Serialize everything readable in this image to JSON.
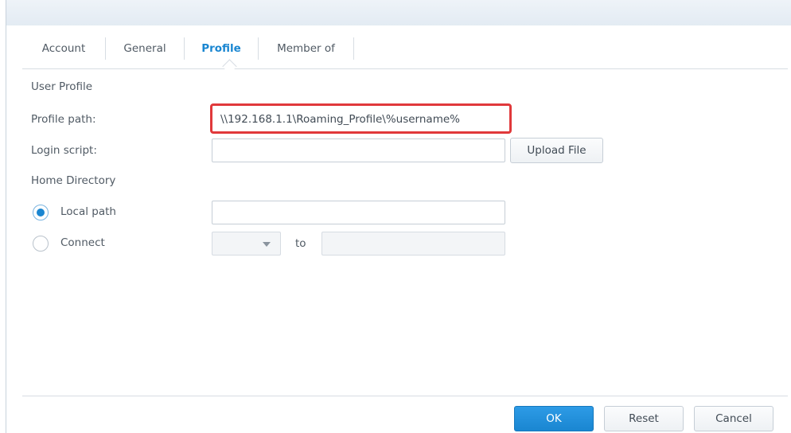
{
  "tabs": [
    {
      "label": "Account",
      "active": false
    },
    {
      "label": "General",
      "active": false
    },
    {
      "label": "Profile",
      "active": true
    },
    {
      "label": "Member of",
      "active": false
    }
  ],
  "user_profile": {
    "section_label": "User Profile",
    "profile_path_label": "Profile path:",
    "profile_path_value": "\\\\192.168.1.1\\Roaming_Profile\\%username%",
    "login_script_label": "Login script:",
    "login_script_value": "",
    "upload_button": "Upload File"
  },
  "home_directory": {
    "section_label": "Home Directory",
    "local_path_label": "Local path",
    "local_path_selected": true,
    "local_path_value": "",
    "connect_label": "Connect",
    "connect_selected": false,
    "drive_value": "",
    "to_label": "to",
    "connect_target_value": ""
  },
  "footer": {
    "ok": "OK",
    "reset": "Reset",
    "cancel": "Cancel"
  },
  "colors": {
    "accent": "#1a86d1",
    "highlight_border": "#e0393b"
  }
}
